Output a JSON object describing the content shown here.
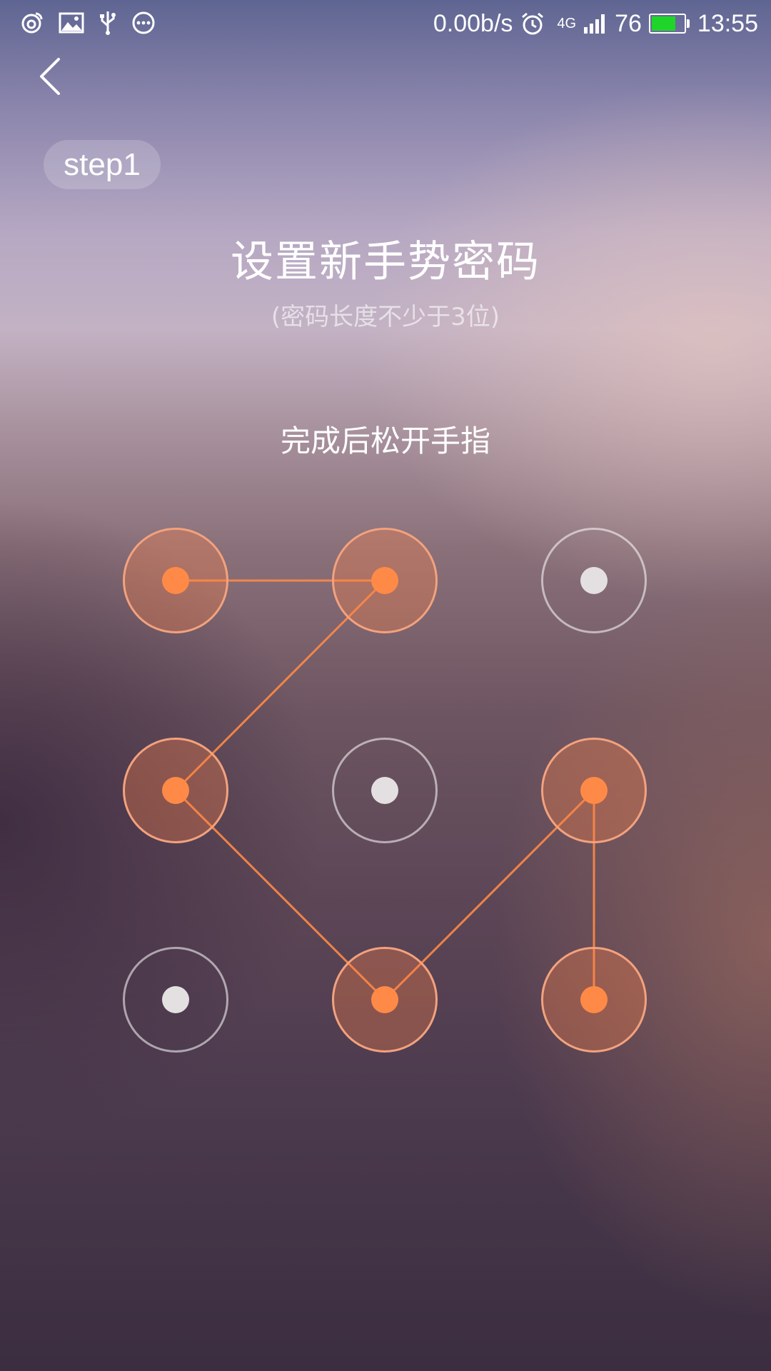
{
  "status_bar": {
    "left_icons": [
      "weibo-icon",
      "image-icon",
      "usb-icon",
      "more-icon"
    ],
    "net_speed": "0.00b/s",
    "alarm_icon": "alarm-icon",
    "network_type": "4G",
    "battery_level": "76",
    "battery_fraction": 0.76,
    "battery_color": "#1fd52a",
    "time": "13:55"
  },
  "header": {
    "back_icon": "chevron-left-icon",
    "step_label": "step1"
  },
  "main": {
    "title": "设置新手势密码",
    "subtitle": "(密码长度不少于3位)",
    "hint": "完成后松开手指"
  },
  "pattern": {
    "grid": 3,
    "selected_color": "#ff8a47",
    "selected_nodes": [
      1,
      2,
      4,
      6,
      8,
      9
    ],
    "path": [
      1,
      2,
      4,
      8,
      6,
      9
    ]
  }
}
